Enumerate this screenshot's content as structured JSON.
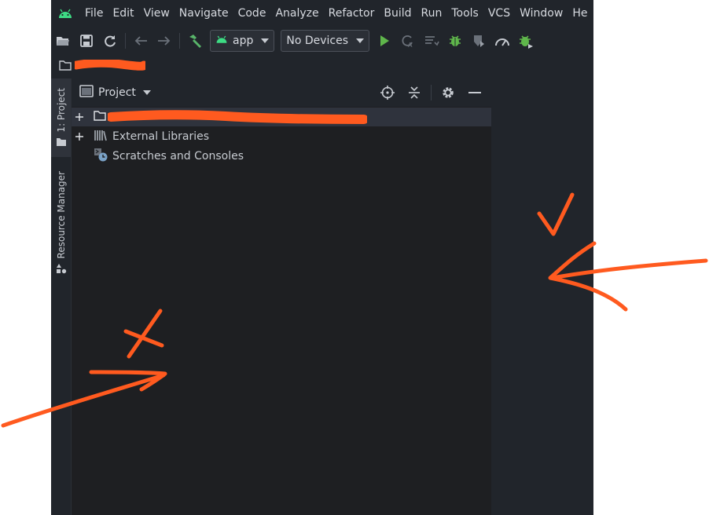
{
  "menu": {
    "items": [
      "File",
      "Edit",
      "View",
      "Navigate",
      "Code",
      "Analyze",
      "Refactor",
      "Build",
      "Run",
      "Tools",
      "VCS",
      "Window",
      "He"
    ]
  },
  "toolbar": {
    "run_config": "app",
    "device": "No Devices"
  },
  "left_strip": {
    "project_tab": "1: Project",
    "resource_tab": "Resource Manager"
  },
  "project_panel": {
    "title": "Project",
    "tree": [
      {
        "label": "",
        "expandable": true,
        "selected": true
      },
      {
        "label": "External Libraries",
        "expandable": true,
        "selected": false
      },
      {
        "label": "Scratches and Consoles",
        "expandable": false,
        "selected": false
      }
    ]
  },
  "colors": {
    "ide_background": "#21252b",
    "panel_background": "#1e1f22",
    "selection": "#2f333d",
    "android_green": "#3ddc84",
    "run_green": "#5fb64b",
    "annotation_orange": "#ff5a1f"
  },
  "annotations": {
    "check_mark": "check-annotation",
    "cross_mark": "cross-annotation",
    "redaction": "redaction-scribble"
  }
}
